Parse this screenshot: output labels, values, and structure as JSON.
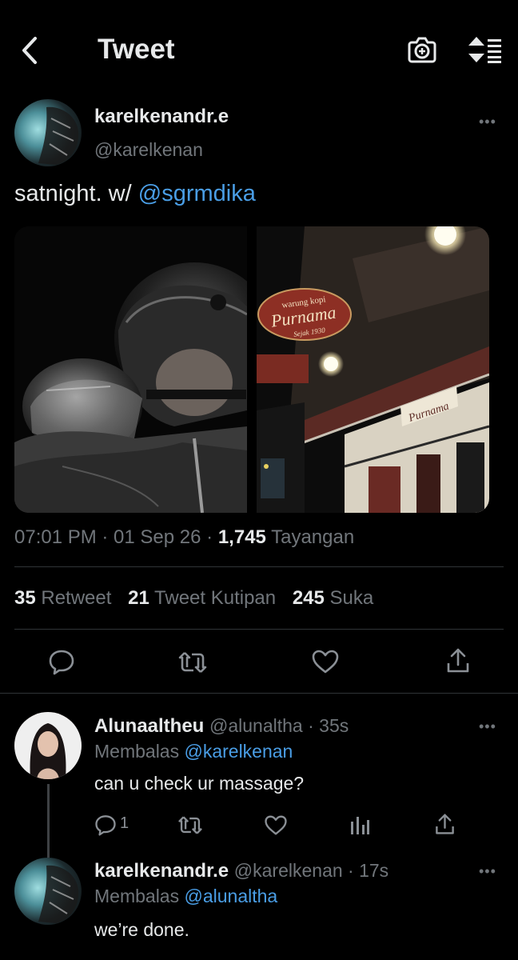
{
  "header": {
    "title": "Tweet",
    "back_icon": "chevron-left-icon",
    "camera_icon": "camera-plus-icon",
    "sort_icon": "sort-icon"
  },
  "tweet": {
    "display_name": "karelkenandr.e",
    "handle": "@karelkenan",
    "text_prefix": "satnight. w/ ",
    "mention": "@sgrmdika",
    "time": "07:01 PM · 01 Sep 26 · ",
    "views_count": "1,745",
    "views_label": " Tayangan",
    "retweets_count": "35",
    "retweets_label": " Retweet",
    "quotes_count": "21",
    "quotes_label": " Tweet Kutipan",
    "likes_count": "245",
    "likes_label": " Suka"
  },
  "replies": [
    {
      "display_name": "Alunaaltheu",
      "handle": "@alunaltha",
      "age": " · 35s",
      "replying_prefix": "Membalas ",
      "replying_to": "@karelkenan",
      "text": "can u check ur massage?",
      "reply_count": "1"
    },
    {
      "display_name": "karelkenandr.e",
      "handle": "@karelkenan",
      "age": " · 17s",
      "replying_prefix": "Membalas ",
      "replying_to": "@alunaltha",
      "text": "we’re done."
    }
  ],
  "photo_sign": {
    "top": "warung kopi",
    "main": "Purnama",
    "sub": "Sejak 1930"
  },
  "colors": {
    "background": "#000000",
    "text": "#e7e9ea",
    "muted": "#71767b",
    "accent": "#4a9ee6",
    "divider": "#2f3336"
  }
}
